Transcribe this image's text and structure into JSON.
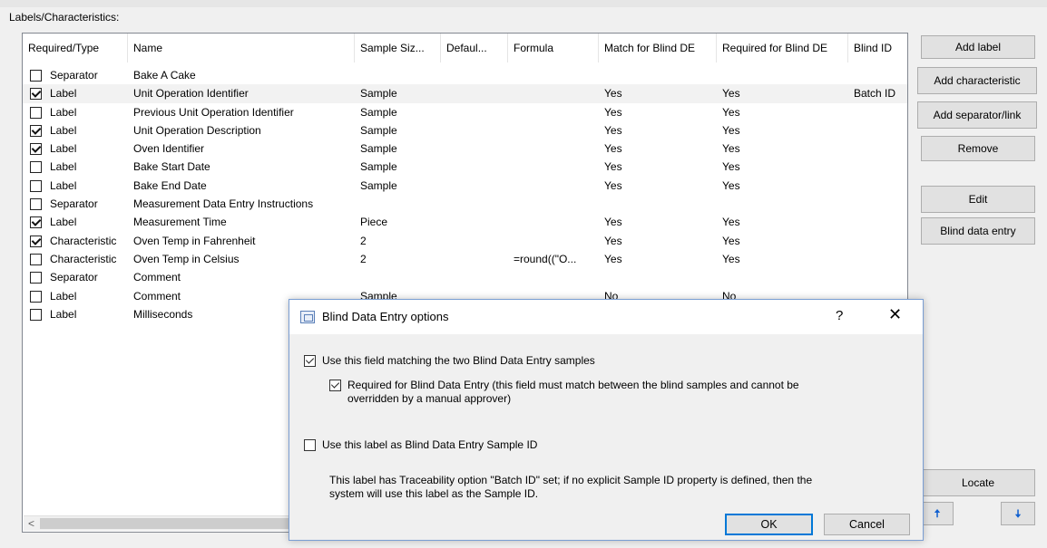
{
  "group_label": "Labels/Characteristics:",
  "columns": [
    "Required/Type",
    "Name",
    "Sample Siz...",
    "Defaul...",
    "Formula",
    "Match for Blind DE",
    "Required for Blind DE",
    "Blind ID"
  ],
  "rows": [
    {
      "checked": false,
      "type": "Separator",
      "name": "Bake A Cake",
      "sample": "",
      "default": "",
      "formula": "",
      "match": "",
      "required": "",
      "blind_id": ""
    },
    {
      "checked": true,
      "type": "Label",
      "name": "Unit Operation Identifier",
      "sample": "Sample",
      "default": "",
      "formula": "",
      "match": "Yes",
      "required": "Yes",
      "blind_id": "Batch ID"
    },
    {
      "checked": false,
      "type": "Label",
      "name": "Previous Unit Operation Identifier",
      "sample": "Sample",
      "default": "",
      "formula": "",
      "match": "Yes",
      "required": "Yes",
      "blind_id": ""
    },
    {
      "checked": true,
      "type": "Label",
      "name": "Unit Operation Description",
      "sample": "Sample",
      "default": "",
      "formula": "",
      "match": "Yes",
      "required": "Yes",
      "blind_id": ""
    },
    {
      "checked": true,
      "type": "Label",
      "name": "Oven Identifier",
      "sample": "Sample",
      "default": "",
      "formula": "",
      "match": "Yes",
      "required": "Yes",
      "blind_id": ""
    },
    {
      "checked": false,
      "type": "Label",
      "name": "Bake Start Date",
      "sample": "Sample",
      "default": "",
      "formula": "",
      "match": "Yes",
      "required": "Yes",
      "blind_id": ""
    },
    {
      "checked": false,
      "type": "Label",
      "name": "Bake End Date",
      "sample": "Sample",
      "default": "",
      "formula": "",
      "match": "Yes",
      "required": "Yes",
      "blind_id": ""
    },
    {
      "checked": false,
      "type": "Separator",
      "name": "Measurement Data Entry Instructions",
      "sample": "",
      "default": "",
      "formula": "",
      "match": "",
      "required": "",
      "blind_id": ""
    },
    {
      "checked": true,
      "type": "Label",
      "name": "Measurement Time",
      "sample": "Piece",
      "default": "",
      "formula": "",
      "match": "Yes",
      "required": "Yes",
      "blind_id": ""
    },
    {
      "checked": true,
      "type": "Characteristic",
      "name": "Oven Temp in Fahrenheit",
      "sample": "2",
      "default": "",
      "formula": "",
      "match": "Yes",
      "required": "Yes",
      "blind_id": ""
    },
    {
      "checked": false,
      "type": "Characteristic",
      "name": "Oven Temp in Celsius",
      "sample": "2",
      "default": "",
      "formula": "=round((\"O...",
      "match": "Yes",
      "required": "Yes",
      "blind_id": ""
    },
    {
      "checked": false,
      "type": "Separator",
      "name": "Comment",
      "sample": "",
      "default": "",
      "formula": "",
      "match": "",
      "required": "",
      "blind_id": ""
    },
    {
      "checked": false,
      "type": "Label",
      "name": "Comment",
      "sample": "Sample",
      "default": "",
      "formula": "",
      "match": "No",
      "required": "No",
      "blind_id": ""
    },
    {
      "checked": false,
      "type": "Label",
      "name": "Milliseconds",
      "sample": "",
      "default": "",
      "formula": "",
      "match": "",
      "required": "",
      "blind_id": ""
    }
  ],
  "buttons": {
    "add_label": "Add label",
    "add_characteristic": "Add characteristic",
    "add_separator": "Add separator/link",
    "remove": "Remove",
    "edit": "Edit",
    "blind_data_entry": "Blind data entry",
    "locate": "Locate",
    "up_arrow": "🠅",
    "down_arrow": "🠇"
  },
  "scroll": {
    "left_arrow": "<"
  },
  "dialog": {
    "title": "Blind Data Entry options",
    "help": "?",
    "close": "✕",
    "opt_match": {
      "checked": true,
      "label": "Use this field matching the two Blind Data Entry samples"
    },
    "opt_required": {
      "checked": true,
      "label_line1": "Required for Blind Data Entry (this field must match between the blind samples and cannot be",
      "label_line2": "overridden by a manual approver)"
    },
    "opt_sample_id": {
      "checked": false,
      "label": "Use this label as Blind Data Entry Sample ID"
    },
    "info_line1": "This label has Traceability option \"Batch ID\" set; if no explicit Sample ID property is defined, then the",
    "info_line2": "system will use this label as the Sample ID.",
    "ok": "OK",
    "cancel": "Cancel"
  }
}
